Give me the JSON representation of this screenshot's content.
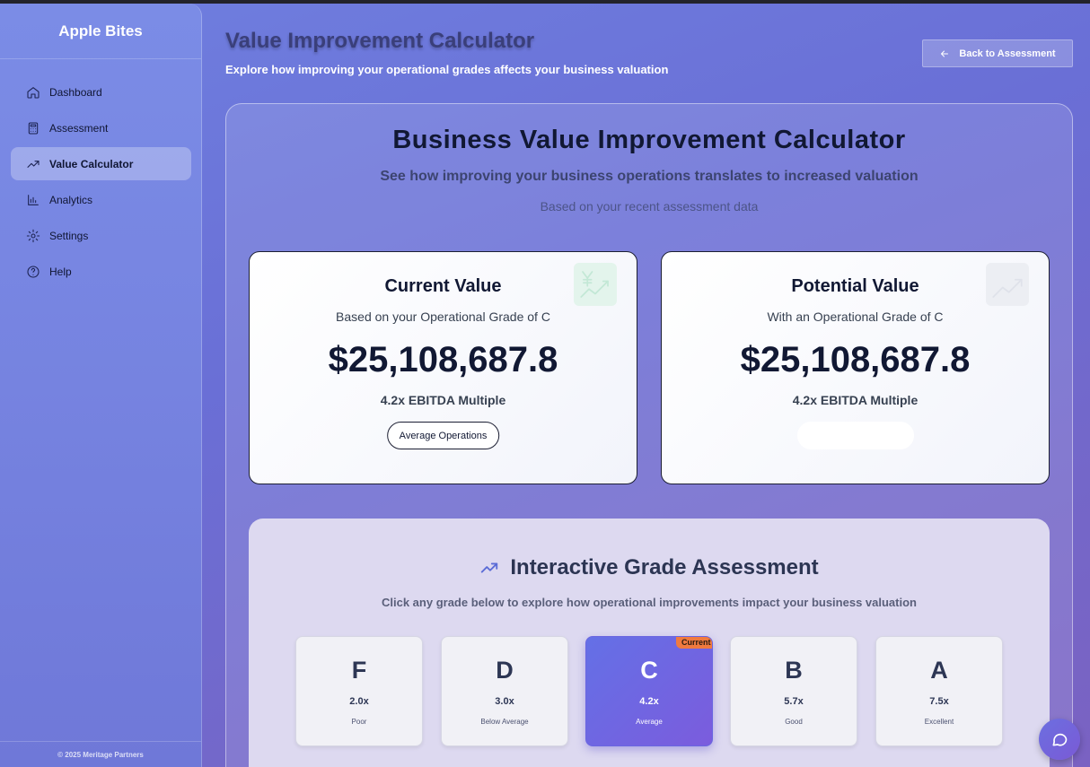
{
  "sidebar": {
    "brand": "Apple Bites",
    "items": [
      {
        "label": "Dashboard",
        "icon": "home-icon"
      },
      {
        "label": "Assessment",
        "icon": "calculator-icon"
      },
      {
        "label": "Value Calculator",
        "icon": "trending-up-icon",
        "active": true
      },
      {
        "label": "Analytics",
        "icon": "bar-chart-icon"
      },
      {
        "label": "Settings",
        "icon": "gear-icon"
      },
      {
        "label": "Help",
        "icon": "help-circle-icon"
      }
    ],
    "footer": "© 2025 Meritage Partners"
  },
  "header": {
    "title": "Value Improvement Calculator",
    "subtitle": "Explore how improving your operational grades affects your business valuation",
    "back_button": "Back to Assessment"
  },
  "main": {
    "title": "Business Value Improvement Calculator",
    "subtitle": "See how improving your business operations translates to increased valuation",
    "note": "Based on your recent assessment data"
  },
  "current": {
    "title": "Current Value",
    "subtitle": "Based on your Operational Grade of C",
    "value": "$25,108,687.8",
    "multiple": "4.2x EBITDA Multiple",
    "badge": "Average Operations",
    "icon": "yen-chart-icon"
  },
  "potential": {
    "title": "Potential Value",
    "subtitle": "With an Operational Grade of C",
    "value": "$25,108,687.8",
    "multiple": "4.2x EBITDA Multiple",
    "icon": "trending-up-icon"
  },
  "grades": {
    "title": "Interactive Grade Assessment",
    "subtitle": "Click any grade below to explore how operational improvements impact your business valuation",
    "current_badge": "Current",
    "items": [
      {
        "letter": "F",
        "multiple": "2.0x",
        "desc": "Poor"
      },
      {
        "letter": "D",
        "multiple": "3.0x",
        "desc": "Below Average"
      },
      {
        "letter": "C",
        "multiple": "4.2x",
        "desc": "Average",
        "active": true
      },
      {
        "letter": "B",
        "multiple": "5.7x",
        "desc": "Good"
      },
      {
        "letter": "A",
        "multiple": "7.5x",
        "desc": "Excellent"
      }
    ]
  },
  "colors": {
    "accent": "#6470e6",
    "badge": "#f07a3f",
    "background": "#6f7fdf"
  }
}
